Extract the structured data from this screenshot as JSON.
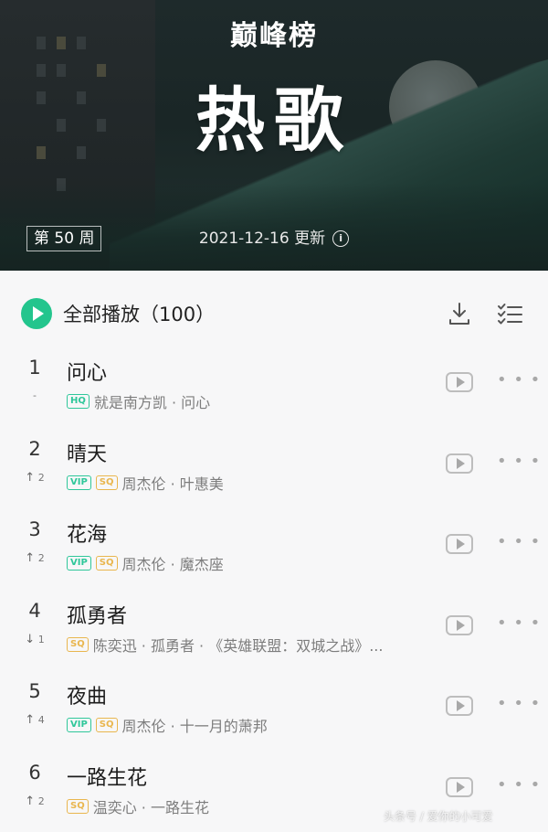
{
  "banner": {
    "brand": "巅峰榜",
    "title": "热歌",
    "week": "第 50 周",
    "update_text": "2021-12-16 更新"
  },
  "toolbar": {
    "play_all_label": "全部播放（100）",
    "icons": [
      "download-icon",
      "multi-select-icon"
    ]
  },
  "colors": {
    "accent_green": "#23c58d",
    "tag_green": "#2fc79a",
    "tag_gold": "#e9b64e"
  },
  "songs": [
    {
      "rank": "1",
      "trend": "-",
      "trend_value": "",
      "name": "问心",
      "tags": [
        "HQ"
      ],
      "meta": "就是南方凯 · 问心"
    },
    {
      "rank": "2",
      "trend": "↑",
      "trend_value": "2",
      "name": "晴天",
      "tags": [
        "VIP",
        "SQ"
      ],
      "meta": "周杰伦 · 叶惠美"
    },
    {
      "rank": "3",
      "trend": "↑",
      "trend_value": "2",
      "name": "花海",
      "tags": [
        "VIP",
        "SQ"
      ],
      "meta": "周杰伦 · 魔杰座"
    },
    {
      "rank": "4",
      "trend": "↓",
      "trend_value": "1",
      "name": "孤勇者",
      "tags": [
        "SQ"
      ],
      "meta": "陈奕迅 · 孤勇者 · 《英雄联盟：双城之战》..."
    },
    {
      "rank": "5",
      "trend": "↑",
      "trend_value": "4",
      "name": "夜曲",
      "tags": [
        "VIP",
        "SQ"
      ],
      "meta": "周杰伦 · 十一月的萧邦"
    },
    {
      "rank": "6",
      "trend": "↑",
      "trend_value": "2",
      "name": "一路生花",
      "tags": [
        "SQ"
      ],
      "meta": "温奕心 · 一路生花"
    }
  ],
  "watermark": "头条号 / 爱你的小可爱"
}
